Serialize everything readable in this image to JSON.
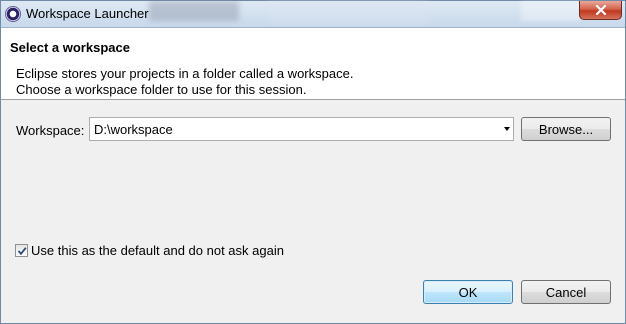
{
  "window": {
    "title": "Workspace Launcher",
    "close_icon": "close-icon",
    "app_icon": "eclipse-icon"
  },
  "header": {
    "title": "Select a workspace",
    "description_line1": "Eclipse stores your projects in a folder called a workspace.",
    "description_line2": "Choose a workspace folder to use for this session."
  },
  "workspace": {
    "label": "Workspace:",
    "value": "D:\\workspace",
    "browse_label": "Browse..."
  },
  "default_option": {
    "label": "Use this as the default and do not ask again",
    "checked": true
  },
  "buttons": {
    "ok": "OK",
    "cancel": "Cancel"
  }
}
